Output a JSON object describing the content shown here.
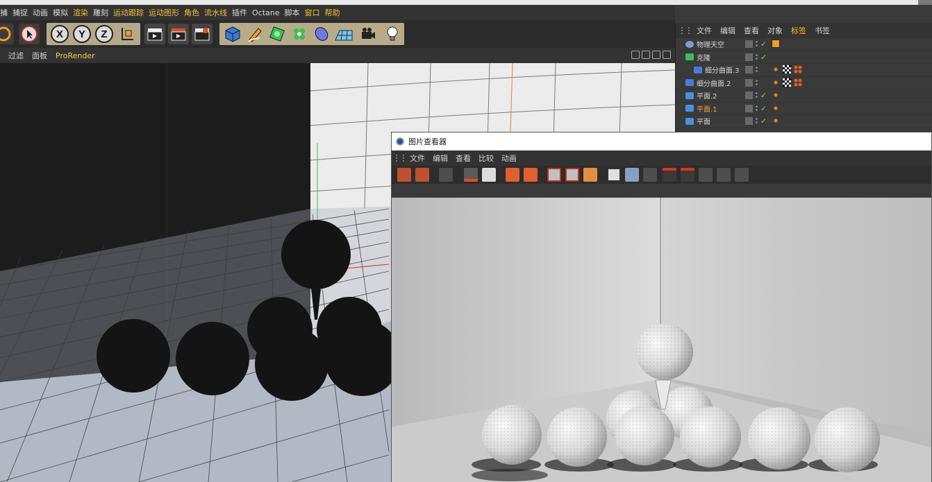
{
  "menubar": {
    "items": [
      {
        "label": "捕",
        "hl": false
      },
      {
        "label": "捕捉",
        "hl": false
      },
      {
        "label": "动画",
        "hl": false
      },
      {
        "label": "模拟",
        "hl": false
      },
      {
        "label": "渲染",
        "hl": true
      },
      {
        "label": "雕刻",
        "hl": false
      },
      {
        "label": "运动跟踪",
        "hl": true
      },
      {
        "label": "运动图形",
        "hl": true
      },
      {
        "label": "角色",
        "hl": true
      },
      {
        "label": "流水线",
        "hl": true
      },
      {
        "label": "插件",
        "hl": false
      },
      {
        "label": "Octane",
        "hl": false
      },
      {
        "label": "脚本",
        "hl": false
      },
      {
        "label": "窗口",
        "hl": true
      },
      {
        "label": "帮助",
        "hl": true
      }
    ]
  },
  "toolbar": {
    "axis_x": "X",
    "axis_y": "Y",
    "axis_z": "Z"
  },
  "viewport_menu": {
    "filter": "过滤",
    "panel": "面板",
    "prorender": "ProRender"
  },
  "object_manager": {
    "menu": [
      "文件",
      "编辑",
      "查看",
      "对象",
      "标签",
      "书签"
    ],
    "active_menu": "标签",
    "objects": [
      {
        "name": "物理天空",
        "orange": false,
        "icon": "sky-icon",
        "indent": 0
      },
      {
        "name": "克隆",
        "orange": false,
        "icon": "cloner-icon",
        "indent": 0
      },
      {
        "name": "细分曲面.3",
        "orange": false,
        "icon": "subdivision-icon",
        "indent": 1
      },
      {
        "name": "细分曲面.2",
        "orange": false,
        "icon": "subdivision-icon",
        "indent": 0
      },
      {
        "name": "平面.2",
        "orange": false,
        "icon": "plane-icon",
        "indent": 0
      },
      {
        "name": "平面.1",
        "orange": true,
        "icon": "plane-icon",
        "indent": 0
      },
      {
        "name": "平面",
        "orange": false,
        "icon": "plane-icon",
        "indent": 0
      }
    ]
  },
  "picture_viewer": {
    "title": "图片查看器",
    "menu": [
      "文件",
      "编辑",
      "查看",
      "比较",
      "动画"
    ]
  },
  "colors": {
    "accent": "#f0c030",
    "menu_bg": "#333333",
    "toolbar_bg": "#2b2b2b"
  }
}
